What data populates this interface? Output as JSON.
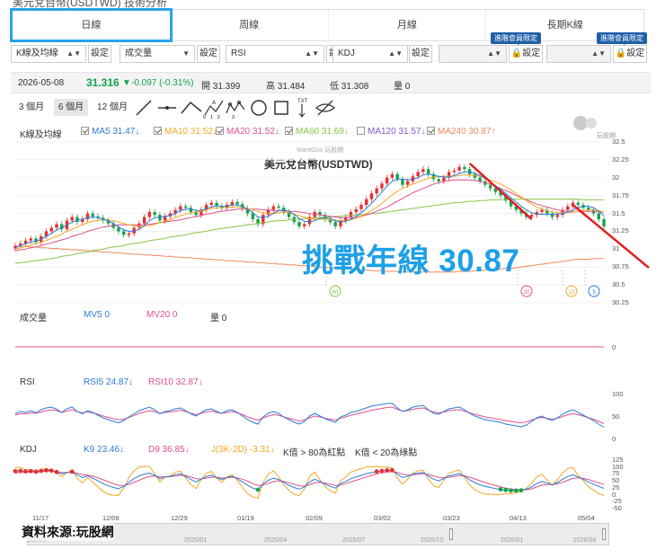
{
  "page": {
    "partial_title": "美元兌台幣(USDTWD) 技術分析"
  },
  "tabs": [
    "日線",
    "周線",
    "月線",
    "長期K線"
  ],
  "controls": {
    "indicator_select": "K線及均線",
    "volume_select": "成交量",
    "rsi_select": "RSI",
    "kdj_select": "KDJ",
    "set_label": "設定",
    "vip_label": "進階會員限定"
  },
  "quote": {
    "date": "2026-05-08",
    "price": "31.316",
    "arrow": "▼",
    "change": "-0.097 (-0.31%)",
    "open": "開 31.399",
    "high": "高 31.484",
    "low": "低 31.308",
    "volume": "量 0"
  },
  "periods": [
    "3 個月",
    "6 個月",
    "12 個月"
  ],
  "tools": [
    "line-tool-icon",
    "ray-tool-icon",
    "wave3-tool-icon",
    "wave5-tool-icon",
    "wave8-tool-icon",
    "circle-tool-icon",
    "rect-tool-icon",
    "text-tool-icon",
    "hide-icon"
  ],
  "tool_text": {
    "abc": "A",
    "a0": "0",
    "a1": "1",
    "a2": "2",
    "a3": "3",
    "txt": "TXT"
  },
  "main_legend": {
    "label": "K線及均線",
    "ma5": "MA5 31.47↓",
    "ma10": "MA10 31.52↓",
    "ma20": "MA20 31.52↓",
    "ma60": "MA60 31.69↓",
    "ma120": "MA120 31.57↓",
    "ma240": "MA240 30.87↑"
  },
  "colors": {
    "ma5": "#2b7bd6",
    "ma10": "#f5a623",
    "ma20": "#e0508a",
    "ma60": "#8bc34a",
    "ma120": "#7c5cc4",
    "ma240": "#f08a5d",
    "up": "#e63030",
    "down": "#16a34a",
    "annotation": "#1ea0e6",
    "arrow": "#e02020"
  },
  "stock_title": "美元兌台幣(USDTWD)",
  "watermark": "WantGoo 玩股網",
  "annotation": "挑戰年線 30.87",
  "markers": [
    "60",
    "20",
    "10",
    "5"
  ],
  "price_axis": [
    "32.5",
    "32.25",
    "32",
    "31.75",
    "31.5",
    "31.25",
    "31",
    "30.75",
    "30.5",
    "30.25"
  ],
  "volume_legend": {
    "label": "成交量",
    "mv5": "MV5 0",
    "mv20": "MV20 0",
    "vol": "量 0",
    "axis": "0"
  },
  "rsi_legend": {
    "label": "RSI",
    "rsi5": "RSI5 24.87↓",
    "rsi10": "RSI10 32.87↓",
    "axis": [
      "100",
      "50",
      "0"
    ]
  },
  "kdj_legend": {
    "label": "KDJ",
    "k9": "K9 23.46↓",
    "d9": "D9 36.85↓",
    "j": "J(3K-2D) -3.31↓",
    "note1": "K值 > 80為紅點",
    "note2": "K值 < 20為綠點",
    "axis": [
      "125",
      "100",
      "75",
      "50",
      "25",
      "0",
      "-25",
      "-50"
    ]
  },
  "x_axis": [
    "11/17",
    "12/08",
    "12/29",
    "01/19",
    "02/09",
    "03/02",
    "03/23",
    "04/13",
    "05/04"
  ],
  "navigator": [
    "2024/07",
    "2025/01",
    "2025/04",
    "2025/07",
    "2025/10",
    "2026/01",
    "2026/04"
  ],
  "source": "資料來源:玩股網",
  "logo_text": "玩股網",
  "chart_data": {
    "type": "candlestick",
    "title": "美元兌台幣(USDTWD)",
    "ylim": [
      30.25,
      32.5
    ],
    "close": [
      31.05,
      31.08,
      31.12,
      31.15,
      31.1,
      31.18,
      31.25,
      31.3,
      31.35,
      31.28,
      31.4,
      31.45,
      31.38,
      31.42,
      31.5,
      31.46,
      31.44,
      31.4,
      31.36,
      31.3,
      31.25,
      31.2,
      31.22,
      31.3,
      31.36,
      31.45,
      31.52,
      31.48,
      31.4,
      31.46,
      31.5,
      31.55,
      31.6,
      31.58,
      31.52,
      31.48,
      31.55,
      31.62,
      31.65,
      31.6,
      31.58,
      31.62,
      31.66,
      31.63,
      31.57,
      31.5,
      31.42,
      31.35,
      31.48,
      31.55,
      31.6,
      31.58,
      31.52,
      31.45,
      31.38,
      31.32,
      31.35,
      31.45,
      31.52,
      31.48,
      31.42,
      31.38,
      31.32,
      31.4,
      31.45,
      31.52,
      31.56,
      31.62,
      31.7,
      31.78,
      31.85,
      31.92,
      32.0,
      32.05,
      31.98,
      31.9,
      31.95,
      32.02,
      32.08,
      32.12,
      32.05,
      31.98,
      31.95,
      32.0,
      32.08,
      32.1,
      32.15,
      32.12,
      32.05,
      32.0,
      31.95,
      31.9,
      31.85,
      31.8,
      31.75,
      31.68,
      31.6,
      31.55,
      31.5,
      31.45,
      31.48,
      31.52,
      31.55,
      31.5,
      31.45,
      31.48,
      31.55,
      31.6,
      31.65,
      31.62,
      31.58,
      31.55,
      31.5,
      31.42,
      31.32
    ],
    "ma5": [
      31.02,
      31.05,
      31.08,
      31.1,
      31.11,
      31.14,
      31.18,
      31.22,
      31.27,
      31.3,
      31.34,
      31.38,
      31.4,
      31.42,
      31.44,
      31.45,
      31.44,
      31.42,
      31.4,
      31.36,
      31.31,
      31.27,
      31.25,
      31.25,
      31.28,
      31.33,
      31.4,
      31.44,
      31.45,
      31.46,
      31.47,
      31.5,
      31.54,
      31.56,
      31.56,
      31.54,
      31.54,
      31.57,
      31.59,
      31.61,
      31.6,
      31.6,
      31.62,
      31.62,
      31.6,
      31.56,
      31.51,
      31.45,
      31.44,
      31.46,
      31.5,
      31.54,
      31.55,
      31.53,
      31.49,
      31.43,
      31.39,
      31.38,
      31.4,
      31.43,
      31.44,
      31.43,
      31.4,
      31.38,
      31.39,
      31.42,
      31.46,
      31.51,
      31.57,
      31.64,
      31.72,
      31.8,
      31.88,
      31.95,
      31.98,
      31.98,
      31.97,
      31.98,
      32.0,
      32.04,
      32.05,
      32.04,
      32.02,
      32.01,
      32.01,
      32.03,
      32.06,
      32.08,
      32.08,
      32.06,
      32.03,
      31.99,
      31.94,
      31.89,
      31.84,
      31.78,
      31.72,
      31.66,
      31.6,
      31.55,
      31.51,
      31.49,
      31.49,
      31.49,
      31.49,
      31.49,
      31.5,
      31.52,
      31.55,
      31.58,
      31.6,
      31.6,
      31.58,
      31.53,
      31.47
    ],
    "ma10": [
      31.0,
      31.02,
      31.04,
      31.06,
      31.08,
      31.1,
      31.12,
      31.15,
      31.18,
      31.21,
      31.25,
      31.28,
      31.31,
      31.34,
      31.37,
      31.39,
      31.4,
      31.41,
      31.41,
      31.4,
      31.38,
      31.36,
      31.34,
      31.33,
      31.32,
      31.32,
      31.33,
      31.35,
      31.37,
      31.39,
      31.41,
      31.44,
      31.47,
      31.49,
      31.51,
      31.52,
      31.53,
      31.55,
      31.57,
      31.58,
      31.58,
      31.58,
      31.59,
      31.59,
      31.58,
      31.57,
      31.55,
      31.53,
      31.51,
      31.5,
      31.5,
      31.51,
      31.52,
      31.51,
      31.49,
      31.47,
      31.45,
      31.43,
      31.42,
      31.42,
      31.42,
      31.41,
      31.4,
      31.4,
      31.4,
      31.41,
      31.43,
      31.46,
      31.5,
      31.54,
      31.59,
      31.64,
      31.7,
      31.76,
      31.81,
      31.85,
      31.88,
      31.91,
      31.94,
      31.97,
      31.99,
      32.01,
      32.02,
      32.02,
      32.02,
      32.02,
      32.03,
      32.04,
      32.04,
      32.03,
      32.02,
      32.0,
      31.97,
      31.94,
      31.91,
      31.87,
      31.83,
      31.78,
      31.73,
      31.68,
      31.63,
      31.59,
      31.56,
      31.54,
      31.52,
      31.51,
      31.51,
      31.51,
      31.52,
      31.53,
      31.54,
      31.55,
      31.55,
      31.54,
      31.52
    ],
    "ma20": [
      30.98,
      30.99,
      31.0,
      31.02,
      31.03,
      31.05,
      31.07,
      31.09,
      31.11,
      31.13,
      31.15,
      31.18,
      31.2,
      31.22,
      31.25,
      31.27,
      31.29,
      31.31,
      31.32,
      31.33,
      31.34,
      31.34,
      31.34,
      31.34,
      31.34,
      31.34,
      31.35,
      31.36,
      31.37,
      31.38,
      31.39,
      31.4,
      31.41,
      31.43,
      31.44,
      31.46,
      31.47,
      31.49,
      31.5,
      31.52,
      31.53,
      31.54,
      31.55,
      31.56,
      31.56,
      31.56,
      31.56,
      31.56,
      31.55,
      31.55,
      31.54,
      31.54,
      31.54,
      31.53,
      31.53,
      31.52,
      31.51,
      31.5,
      31.49,
      31.48,
      31.47,
      31.46,
      31.45,
      31.44,
      31.44,
      31.44,
      31.45,
      31.46,
      31.48,
      31.5,
      31.53,
      31.56,
      31.59,
      31.63,
      31.67,
      31.71,
      31.75,
      31.79,
      31.82,
      31.85,
      31.88,
      31.91,
      31.93,
      31.95,
      31.96,
      31.97,
      31.97,
      31.97,
      31.97,
      31.96,
      31.95,
      31.93,
      31.91,
      31.88,
      31.85,
      31.82,
      31.79,
      31.75,
      31.72,
      31.69,
      31.66,
      31.63,
      31.61,
      31.59,
      31.57,
      31.55,
      31.54,
      31.53,
      31.53,
      31.53,
      31.53,
      31.53,
      31.53,
      31.52,
      31.52
    ],
    "ma60": [
      30.8,
      30.81,
      30.82,
      30.83,
      30.84,
      30.85,
      30.86,
      30.87,
      30.88,
      30.9,
      30.91,
      30.92,
      30.94,
      30.95,
      30.96,
      30.98,
      30.99,
      31.0,
      31.02,
      31.03,
      31.04,
      31.05,
      31.07,
      31.08,
      31.09,
      31.1,
      31.12,
      31.13,
      31.14,
      31.15,
      31.17,
      31.18,
      31.19,
      31.2,
      31.22,
      31.23,
      31.24,
      31.25,
      31.27,
      31.28,
      31.29,
      31.3,
      31.31,
      31.32,
      31.33,
      31.34,
      31.35,
      31.36,
      31.37,
      31.38,
      31.39,
      31.4,
      31.4,
      31.41,
      31.42,
      31.42,
      31.43,
      31.43,
      31.44,
      31.44,
      31.45,
      31.45,
      31.46,
      31.46,
      31.47,
      31.47,
      31.48,
      31.48,
      31.49,
      31.5,
      31.5,
      31.51,
      31.52,
      31.53,
      31.54,
      31.55,
      31.56,
      31.57,
      31.58,
      31.59,
      31.6,
      31.61,
      31.62,
      31.63,
      31.64,
      31.65,
      31.65,
      31.66,
      31.67,
      31.67,
      31.68,
      31.68,
      31.69,
      31.69,
      31.69,
      31.7,
      31.7,
      31.7,
      31.7,
      31.7,
      31.7,
      31.7,
      31.7,
      31.7,
      31.7,
      31.7,
      31.7,
      31.7,
      31.7,
      31.7,
      31.69,
      31.69,
      31.69,
      31.69,
      31.69
    ],
    "ma240": [
      31.05,
      31.04,
      31.04,
      31.03,
      31.03,
      31.02,
      31.02,
      31.01,
      31.01,
      31.0,
      31.0,
      30.99,
      30.99,
      30.98,
      30.98,
      30.97,
      30.97,
      30.96,
      30.96,
      30.95,
      30.95,
      30.94,
      30.94,
      30.93,
      30.93,
      30.92,
      30.92,
      30.91,
      30.91,
      30.9,
      30.9,
      30.89,
      30.89,
      30.88,
      30.88,
      30.87,
      30.87,
      30.86,
      30.86,
      30.85,
      30.85,
      30.84,
      30.84,
      30.83,
      30.83,
      30.82,
      30.82,
      30.81,
      30.81,
      30.8,
      30.8,
      30.79,
      30.79,
      30.78,
      30.78,
      30.77,
      30.77,
      30.76,
      30.76,
      30.75,
      30.75,
      30.74,
      30.74,
      30.73,
      30.73,
      30.72,
      30.72,
      30.71,
      30.71,
      30.7,
      30.7,
      30.7,
      30.69,
      30.69,
      30.69,
      30.68,
      30.68,
      30.68,
      30.68,
      30.68,
      30.68,
      30.68,
      30.68,
      30.68,
      30.68,
      30.68,
      30.69,
      30.69,
      30.69,
      30.7,
      30.7,
      30.71,
      30.71,
      30.72,
      30.72,
      30.73,
      30.73,
      30.74,
      30.75,
      30.76,
      30.77,
      30.78,
      30.79,
      30.8,
      30.81,
      30.82,
      30.83,
      30.84,
      30.85,
      30.86,
      30.86,
      30.86,
      30.87,
      30.87,
      30.87
    ],
    "rsi5": [
      55,
      60,
      58,
      62,
      57,
      64,
      68,
      70,
      65,
      58,
      66,
      70,
      60,
      55,
      62,
      58,
      52,
      46,
      42,
      38,
      35,
      40,
      48,
      55,
      62,
      66,
      70,
      64,
      55,
      60,
      62,
      66,
      68,
      62,
      55,
      50,
      58,
      64,
      66,
      60,
      56,
      62,
      64,
      58,
      50,
      42,
      36,
      32,
      48,
      56,
      60,
      56,
      48,
      42,
      36,
      32,
      38,
      50,
      56,
      50,
      44,
      40,
      36,
      48,
      52,
      58,
      60,
      64,
      68,
      72,
      74,
      76,
      78,
      78,
      68,
      60,
      64,
      70,
      72,
      74,
      64,
      56,
      54,
      60,
      66,
      68,
      70,
      64,
      56,
      50,
      46,
      42,
      40,
      38,
      36,
      32,
      30,
      28,
      26,
      30,
      38,
      46,
      50,
      44,
      40,
      46,
      54,
      60,
      64,
      58,
      52,
      46,
      40,
      32,
      25
    ],
    "rsi10": [
      52,
      55,
      55,
      57,
      56,
      59,
      62,
      64,
      62,
      58,
      61,
      64,
      60,
      57,
      59,
      57,
      54,
      50,
      47,
      44,
      42,
      43,
      47,
      51,
      56,
      59,
      62,
      60,
      56,
      58,
      59,
      61,
      63,
      60,
      56,
      53,
      56,
      59,
      61,
      58,
      56,
      58,
      60,
      57,
      53,
      48,
      44,
      41,
      46,
      50,
      53,
      52,
      48,
      45,
      42,
      39,
      41,
      46,
      50,
      48,
      45,
      43,
      41,
      45,
      48,
      52,
      54,
      57,
      60,
      63,
      65,
      67,
      69,
      70,
      65,
      61,
      62,
      65,
      67,
      68,
      63,
      59,
      57,
      59,
      62,
      63,
      64,
      61,
      57,
      54,
      51,
      48,
      46,
      44,
      42,
      40,
      38,
      36,
      35,
      37,
      41,
      45,
      47,
      45,
      43,
      45,
      49,
      53,
      55,
      53,
      50,
      46,
      43,
      38,
      33
    ],
    "k9": [
      85,
      86,
      84,
      85,
      83,
      86,
      88,
      87,
      82,
      75,
      80,
      83,
      72,
      62,
      68,
      60,
      50,
      40,
      32,
      26,
      22,
      30,
      45,
      58,
      68,
      74,
      78,
      70,
      58,
      64,
      66,
      72,
      75,
      66,
      55,
      46,
      56,
      66,
      70,
      62,
      55,
      62,
      66,
      58,
      46,
      34,
      24,
      18,
      38,
      52,
      60,
      55,
      44,
      34,
      26,
      20,
      28,
      46,
      56,
      48,
      38,
      30,
      24,
      40,
      48,
      58,
      64,
      70,
      76,
      80,
      84,
      86,
      88,
      88,
      74,
      62,
      66,
      74,
      78,
      80,
      68,
      56,
      50,
      58,
      68,
      72,
      76,
      66,
      54,
      44,
      36,
      30,
      26,
      22,
      19,
      17,
      15,
      15,
      16,
      20,
      28,
      40,
      48,
      42,
      36,
      44,
      56,
      66,
      72,
      64,
      56,
      46,
      38,
      30,
      23
    ],
    "d9": [
      78,
      80,
      81,
      82,
      82,
      83,
      85,
      86,
      84,
      80,
      80,
      81,
      78,
      72,
      71,
      67,
      61,
      54,
      47,
      40,
      34,
      33,
      37,
      44,
      52,
      60,
      66,
      67,
      64,
      64,
      65,
      67,
      70,
      69,
      64,
      58,
      57,
      60,
      63,
      63,
      60,
      61,
      63,
      61,
      56,
      49,
      40,
      33,
      35,
      41,
      47,
      50,
      48,
      43,
      38,
      32,
      31,
      36,
      43,
      45,
      42,
      38,
      33,
      35,
      40,
      46,
      52,
      58,
      64,
      70,
      75,
      79,
      82,
      84,
      81,
      74,
      71,
      72,
      74,
      76,
      73,
      68,
      62,
      61,
      63,
      66,
      69,
      68,
      63,
      57,
      50,
      44,
      38,
      33,
      28,
      24,
      21,
      19,
      18,
      18,
      21,
      28,
      35,
      37,
      37,
      39,
      45,
      52,
      59,
      61,
      59,
      55,
      49,
      43,
      37
    ],
    "j": [
      99,
      98,
      90,
      91,
      85,
      92,
      94,
      89,
      78,
      65,
      80,
      87,
      60,
      42,
      62,
      46,
      28,
      12,
      2,
      -2,
      -2,
      24,
      61,
      86,
      100,
      102,
      102,
      76,
      46,
      64,
      68,
      82,
      85,
      60,
      37,
      22,
      54,
      78,
      84,
      60,
      45,
      64,
      72,
      52,
      26,
      4,
      -8,
      -12,
      44,
      74,
      86,
      65,
      36,
      16,
      2,
      -4,
      22,
      66,
      82,
      54,
      30,
      14,
      6,
      50,
      64,
      82,
      88,
      94,
      100,
      100,
      102,
      100,
      100,
      96,
      60,
      38,
      56,
      78,
      86,
      88,
      58,
      32,
      26,
      52,
      78,
      84,
      90,
      62,
      36,
      18,
      8,
      2,
      2,
      0,
      1,
      3,
      3,
      7,
      12,
      24,
      42,
      64,
      74,
      52,
      34,
      54,
      78,
      94,
      98,
      70,
      50,
      28,
      16,
      4,
      -3
    ]
  }
}
